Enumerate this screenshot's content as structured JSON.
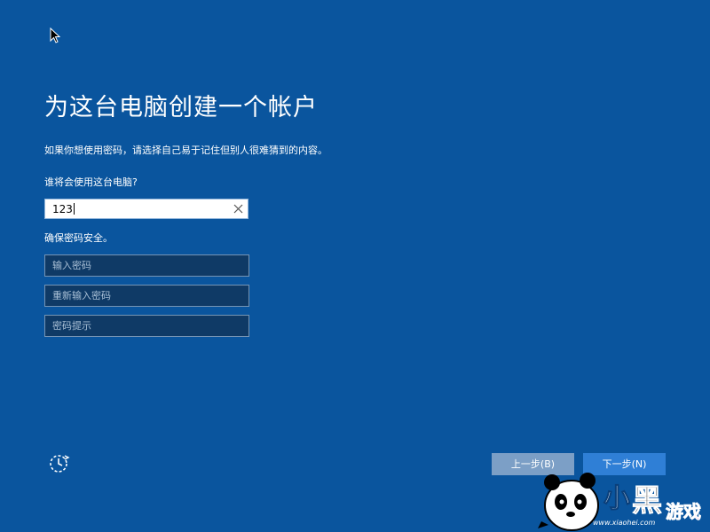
{
  "setup": {
    "title": "为这台电脑创建一个帐户",
    "subtitle": "如果你想使用密码，请选择自己易于记住但别人很难猜到的内容。",
    "who_label": "谁将会使用这台电脑?",
    "username_value": "123",
    "secure_label": "确保密码安全。",
    "password_placeholder": "输入密码",
    "reenter_placeholder": "重新输入密码",
    "hint_placeholder": "密码提示"
  },
  "buttons": {
    "back_label": "上一步(B)",
    "next_label": "下一步(N)"
  },
  "icons": {
    "cursor": "arrow-cursor-icon",
    "clear": "close-icon",
    "ease_of_access": "ease-of-access-icon"
  },
  "watermark": {
    "logo_text": "小黑游戏",
    "site": "www.xiaohei.com"
  },
  "colors": {
    "background": "#0a559e",
    "next_button": "#2f7fd6",
    "back_button": "#7c9fc6",
    "field_background": "#0f3a66"
  }
}
